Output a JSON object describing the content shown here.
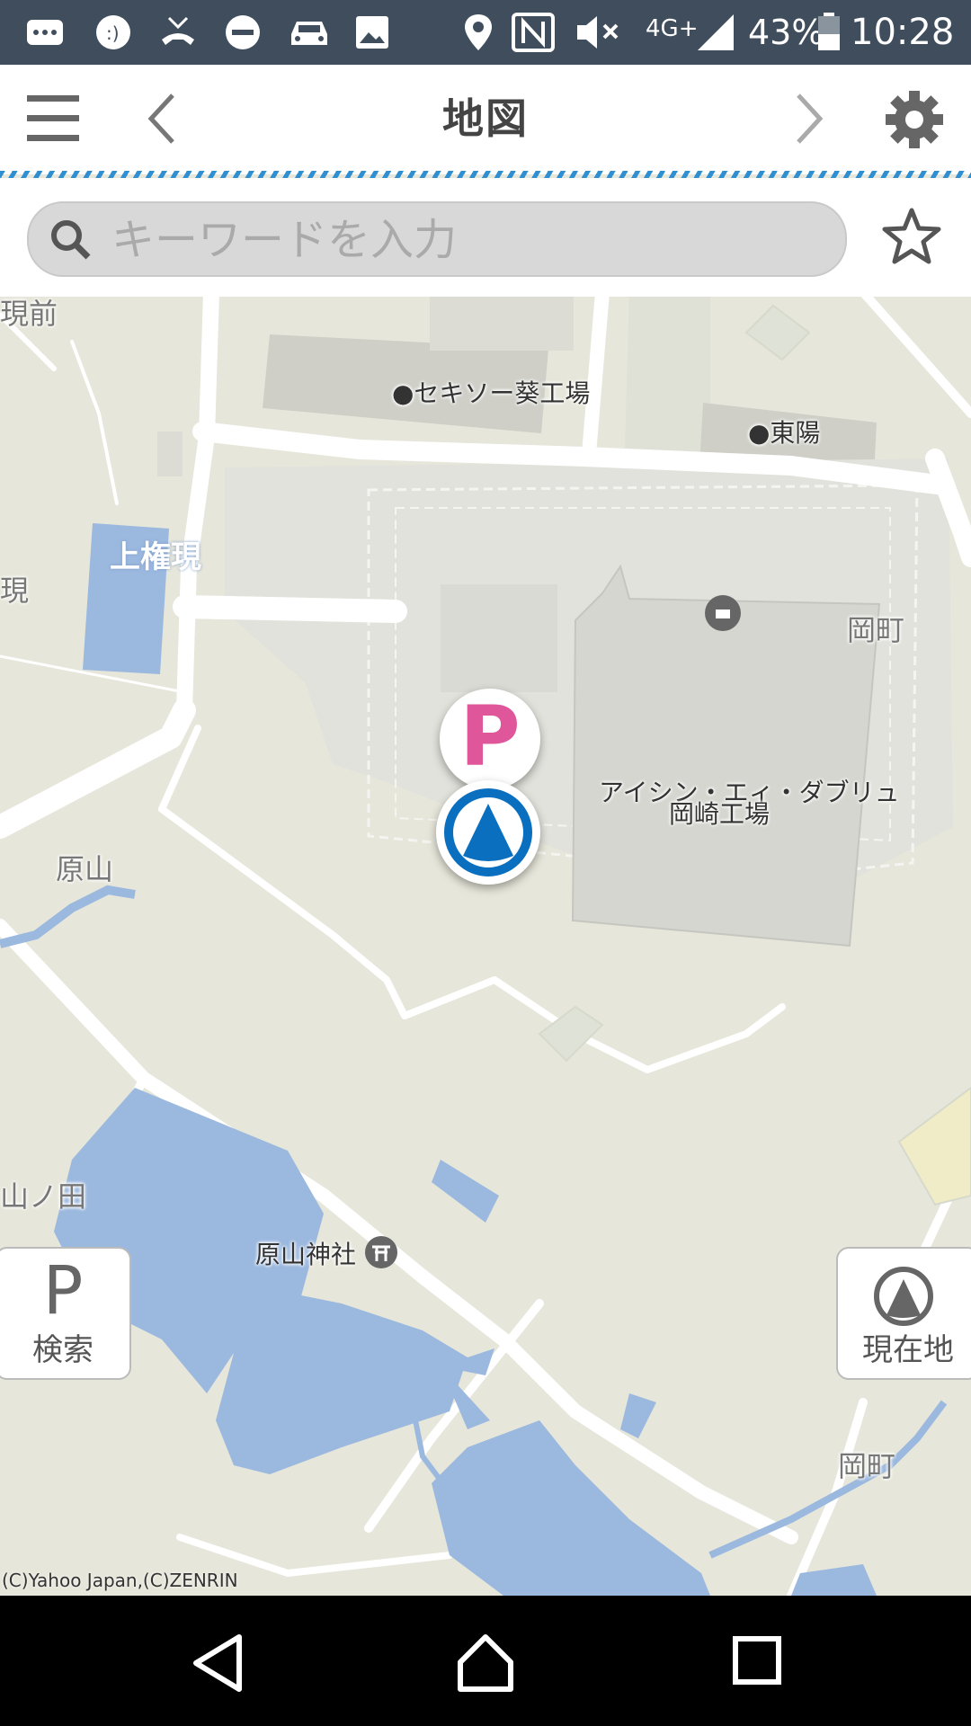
{
  "status_bar": {
    "network": "4G+",
    "battery": "43%",
    "time": "10:28",
    "icons": [
      "sms-icon",
      "smiley-icon",
      "missed-call-icon",
      "dnd-icon",
      "car-icon",
      "image-icon",
      "location-icon",
      "nfc-icon",
      "mute-icon",
      "signal-icon",
      "battery-icon"
    ]
  },
  "header": {
    "title": "地図",
    "menu_icon": "menu-icon",
    "back_icon": "chevron-left-icon",
    "forward_icon": "chevron-right-icon",
    "settings_icon": "gear-icon"
  },
  "search": {
    "placeholder": "キーワードを入力",
    "favorite_icon": "star-icon"
  },
  "map": {
    "labels": {
      "sekisui": "●セキソー葵工場",
      "toyo": "●東陽",
      "kamigongen": "上権現",
      "okacho1": "岡町",
      "factory_line1": "アイシン・エィ・ダブリュ",
      "factory_line2": "岡崎工場",
      "harayama": "原山",
      "yamanota": "山ノ田",
      "shrine": "原山神社",
      "okacho2": "岡町",
      "edge_left1": "現前",
      "edge_left2": "現"
    },
    "parking_pin": "P",
    "copyright": "(C)Yahoo Japan,(C)ZENRIN"
  },
  "buttons": {
    "parking_search_letter": "P",
    "parking_search": "検索",
    "current_location": "現在地"
  },
  "nav_bar": {
    "back": "back-icon",
    "home": "home-icon",
    "recents": "recents-icon"
  },
  "colors": {
    "status_bar": "#3f4d5c",
    "accent_blue": "#0a6fbf",
    "parking_pink": "#e0569a",
    "water": "#9bb8df",
    "land": "#e6e6da",
    "building": "#d6d6d0"
  }
}
